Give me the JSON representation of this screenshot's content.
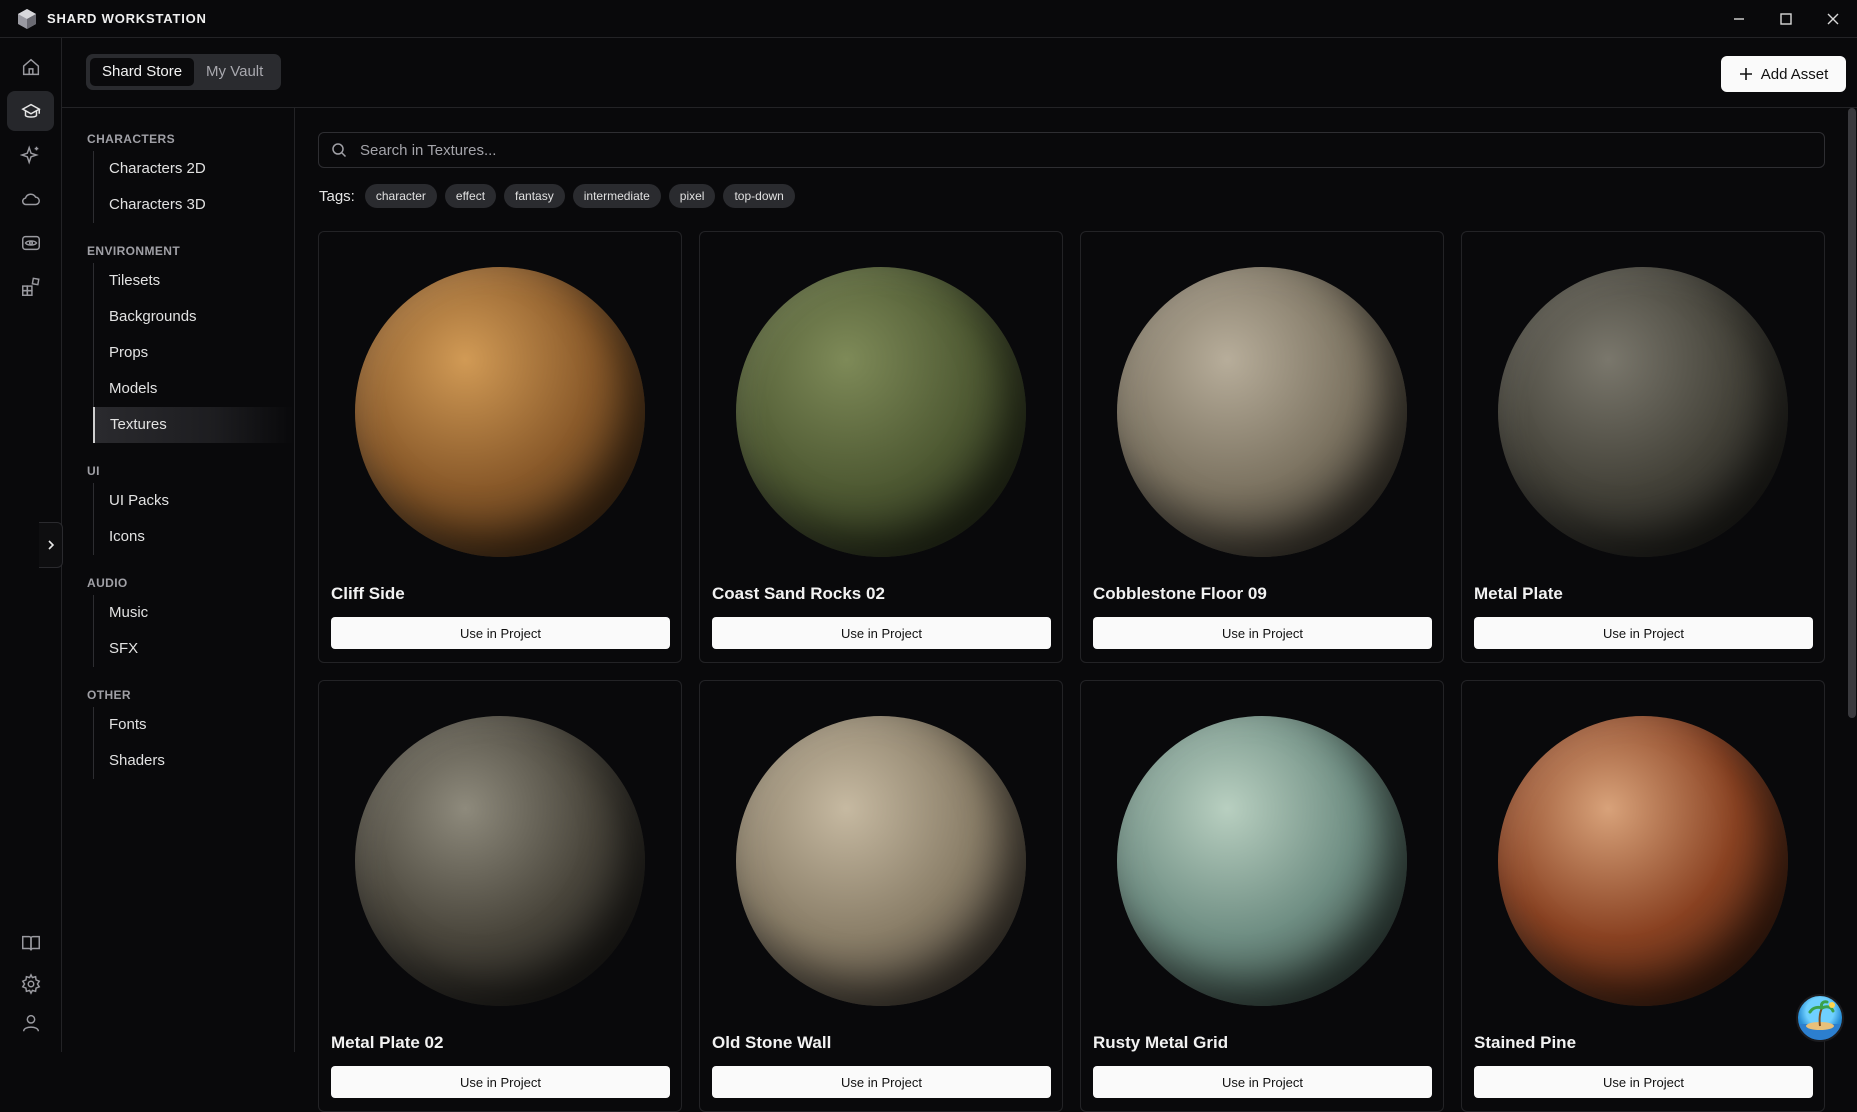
{
  "app": {
    "title": "SHARD WORKSTATION"
  },
  "window_controls": {
    "minimize_icon": "minimize-icon",
    "maximize_icon": "maximize-icon",
    "close_icon": "close-icon"
  },
  "rail": {
    "items": [
      {
        "icon": "home-icon",
        "active": false
      },
      {
        "icon": "store-icon",
        "active": true
      },
      {
        "icon": "sparkles-icon",
        "active": false
      },
      {
        "icon": "cloud-icon",
        "active": false
      },
      {
        "icon": "eye-icon",
        "active": false
      },
      {
        "icon": "blocks-icon",
        "active": false
      }
    ],
    "bottom": [
      "book-icon",
      "gear-icon",
      "user-icon"
    ]
  },
  "topbar": {
    "tabs": [
      {
        "label": "Shard Store",
        "active": true
      },
      {
        "label": "My Vault",
        "active": false
      }
    ],
    "add_label": "Add Asset"
  },
  "sidebar": {
    "sections": [
      {
        "heading": "CHARACTERS",
        "items": [
          "Characters 2D",
          "Characters 3D"
        ]
      },
      {
        "heading": "ENVIRONMENT",
        "items": [
          "Tilesets",
          "Backgrounds",
          "Props",
          "Models",
          "Textures"
        ]
      },
      {
        "heading": "UI",
        "items": [
          "UI Packs",
          "Icons"
        ]
      },
      {
        "heading": "AUDIO",
        "items": [
          "Music",
          "SFX"
        ]
      },
      {
        "heading": "OTHER",
        "items": [
          "Fonts",
          "Shaders"
        ]
      }
    ],
    "active_item": "Textures"
  },
  "search": {
    "placeholder": "Search in Textures..."
  },
  "tags": {
    "label": "Tags:",
    "items": [
      "character",
      "effect",
      "fantasy",
      "intermediate",
      "pixel",
      "top-down"
    ]
  },
  "assets": [
    {
      "title": "Cliff Side",
      "button": "Use in Project",
      "colors": [
        "#d19a55",
        "#8a5a2a",
        "#3a2410"
      ]
    },
    {
      "title": "Coast Sand Rocks 02",
      "button": "Use in Project",
      "colors": [
        "#7e8a58",
        "#4f5a33",
        "#1e2414"
      ]
    },
    {
      "title": "Cobblestone Floor 09",
      "button": "Use in Project",
      "colors": [
        "#b7ad9a",
        "#7d7462",
        "#2c2821"
      ]
    },
    {
      "title": "Metal Plate",
      "button": "Use in Project",
      "colors": [
        "#7a776c",
        "#45433a",
        "#141412"
      ]
    },
    {
      "title": "Metal Plate 02",
      "button": "Use in Project",
      "colors": [
        "#8e8a7c",
        "#4a463c",
        "#121110"
      ]
    },
    {
      "title": "Old Stone Wall",
      "button": "Use in Project",
      "colors": [
        "#c6b9a1",
        "#8a7e68",
        "#36302a"
      ]
    },
    {
      "title": "Rusty Metal Grid",
      "button": "Use in Project",
      "colors": [
        "#b8cfc0",
        "#6f8e83",
        "#2a3a34"
      ]
    },
    {
      "title": "Stained Pine",
      "button": "Use in Project",
      "colors": [
        "#d8a27a",
        "#8a4222",
        "#2e150a"
      ]
    }
  ]
}
